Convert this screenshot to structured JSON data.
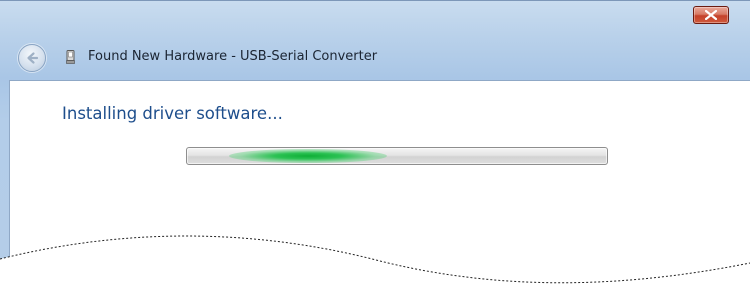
{
  "window": {
    "title": "Found New Hardware - USB-Serial Converter",
    "close_icon": "close-icon",
    "back_icon": "back-arrow-icon",
    "device_icon": "usb-device-icon"
  },
  "content": {
    "main_instruction": "Installing driver software...",
    "progress": {
      "state": "indeterminate",
      "color": "#1bb247"
    }
  },
  "colors": {
    "frame": "#b4cde8",
    "instruction_text": "#1e4e8c",
    "close_button": "#c4412a"
  }
}
